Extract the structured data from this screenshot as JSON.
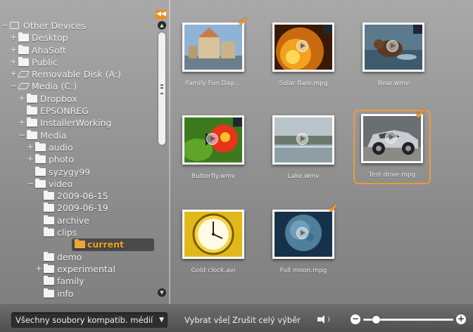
{
  "tree": {
    "collapse_label": "◀◀",
    "nodes": [
      {
        "label": "Other Devices",
        "toggle": "−",
        "icon": "computer-icon"
      },
      {
        "label": "Desktop",
        "toggle": "+",
        "icon": "folder-icon"
      },
      {
        "label": "AhaSoft",
        "toggle": "+",
        "icon": "folder-icon"
      },
      {
        "label": "Public",
        "toggle": "+",
        "icon": "folder-icon"
      },
      {
        "label": "Removable Disk (A:)",
        "toggle": "+",
        "icon": "drive-icon"
      },
      {
        "label": "Media (C:)",
        "toggle": "−",
        "icon": "drive-icon"
      },
      {
        "label": "Dropbox",
        "toggle": "+",
        "icon": "folder-icon"
      },
      {
        "label": "EPSONREG",
        "toggle": "",
        "icon": "folder-icon"
      },
      {
        "label": "InstallerWorking",
        "toggle": "+",
        "icon": "folder-icon"
      },
      {
        "label": "Media",
        "toggle": "−",
        "icon": "folder-icon"
      },
      {
        "label": "audio",
        "toggle": "+",
        "icon": "folder-icon"
      },
      {
        "label": "photo",
        "toggle": "+",
        "icon": "folder-icon"
      },
      {
        "label": "syzygy99",
        "toggle": "",
        "icon": "folder-icon"
      },
      {
        "label": "video",
        "toggle": "−",
        "icon": "folder-icon"
      },
      {
        "label": "2009-06-15",
        "toggle": "",
        "icon": "folder-icon"
      },
      {
        "label": "2009-06-19",
        "toggle": "",
        "icon": "folder-icon"
      },
      {
        "label": "archive",
        "toggle": "",
        "icon": "folder-icon"
      },
      {
        "label": "clips",
        "toggle": "",
        "icon": "folder-icon"
      },
      {
        "label": "current",
        "toggle": "",
        "icon": "folder-icon",
        "selected": true
      },
      {
        "label": "demo",
        "toggle": "",
        "icon": "folder-icon"
      },
      {
        "label": "experimental",
        "toggle": "+",
        "icon": "folder-icon"
      },
      {
        "label": "family",
        "toggle": "",
        "icon": "folder-icon"
      },
      {
        "label": "info",
        "toggle": "",
        "icon": "folder-icon"
      }
    ]
  },
  "media": {
    "items": [
      {
        "name": "Family Fun Day....",
        "checked": true,
        "selected": false,
        "icon": "photo-thumbnail"
      },
      {
        "name": "Solar flare.mpg",
        "checked": false,
        "selected": false,
        "icon": "video-thumbnail"
      },
      {
        "name": "Bear.wmv",
        "checked": false,
        "selected": false,
        "icon": "video-thumbnail"
      },
      {
        "name": "Butterfly.wmv",
        "checked": false,
        "selected": false,
        "icon": "video-thumbnail"
      },
      {
        "name": "Lake.wmv",
        "checked": false,
        "selected": false,
        "icon": "video-thumbnail"
      },
      {
        "name": "Test drive.mpg",
        "checked": true,
        "selected": true,
        "icon": "video-thumbnail"
      },
      {
        "name": "Gold clock.avi",
        "checked": false,
        "selected": false,
        "icon": "video-thumbnail"
      },
      {
        "name": "Full moon.mpg",
        "checked": true,
        "selected": false,
        "icon": "video-thumbnail"
      }
    ]
  },
  "bottom": {
    "filter_value": "Všechny soubory kompatib. médií",
    "select_all": "Vybrat vše",
    "separator": "|",
    "deselect_all": "Zrušit celý výběr",
    "zoom_minus": "−",
    "zoom_plus": "+",
    "zoom_level": 0.14
  },
  "colors": {
    "accent": "#f39a1e",
    "selected_row": "#4a4a4a"
  }
}
